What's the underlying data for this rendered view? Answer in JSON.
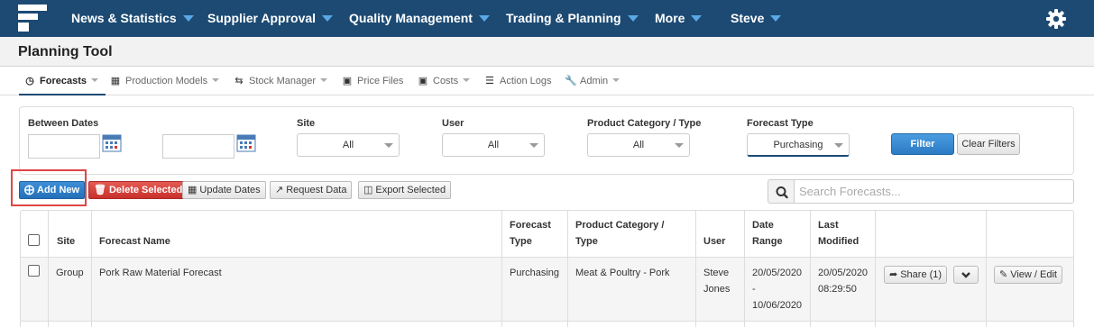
{
  "nav": {
    "logo_icon": "logo-icon",
    "items": [
      {
        "label": "News & Statistics"
      },
      {
        "label": "Supplier Approval"
      },
      {
        "label": "Quality Management"
      },
      {
        "label": "Trading & Planning"
      },
      {
        "label": "More"
      },
      {
        "label": "Steve"
      }
    ],
    "settings_icon": "gear-icon",
    "background": "#1c4a73"
  },
  "page": {
    "title": "Planning Tool"
  },
  "subnav": [
    {
      "label": "Forecasts",
      "icon": "clock-icon",
      "active": true
    },
    {
      "label": "Production Models",
      "icon": "calculator-icon"
    },
    {
      "label": "Stock Manager",
      "icon": "retweet-icon"
    },
    {
      "label": "Price Files",
      "icon": "money-icon"
    },
    {
      "label": "Costs",
      "icon": "money-icon"
    },
    {
      "label": "Action Logs",
      "icon": "list-icon"
    },
    {
      "label": "Admin",
      "icon": "wrench-icon"
    }
  ],
  "filters": {
    "between_dates_label": "Between Dates",
    "date_from": "",
    "date_to": "",
    "site_label": "Site",
    "site_value": "All",
    "user_label": "User",
    "user_value": "All",
    "category_label": "Product Category / Type",
    "category_value": "All",
    "forecast_type_label": "Forecast Type",
    "forecast_type_value": "Purchasing",
    "filter_button": "Filter",
    "clear_button": "Clear Filters"
  },
  "toolbar": {
    "add_new": "Add New",
    "delete_selected": "Delete Selected",
    "update_dates": "Update Dates",
    "request_data": "Request Data",
    "export_selected": "Export Selected",
    "search_placeholder": "Search Forecasts...",
    "search_value": ""
  },
  "table": {
    "headers": {
      "site": "Site",
      "forecast_name": "Forecast Name",
      "forecast_type_1": "Forecast",
      "forecast_type_2": "Type",
      "category_1": "Product Category /",
      "category_2": "Type",
      "user": "User",
      "date_range_1": "Date",
      "date_range_2": "Range",
      "last_modified_1": "Last",
      "last_modified_2": "Modified"
    },
    "rows": [
      {
        "site": "Group",
        "forecast_name": "Pork Raw Material Forecast",
        "forecast_type": "Purchasing",
        "category": "Meat & Poultry - Pork",
        "user_1": "Steve",
        "user_2": "Jones",
        "date_from": "20/05/2020",
        "date_sep": "-",
        "date_to": "10/06/2020",
        "modified_date": "20/05/2020",
        "modified_time": "08:29:50",
        "share_label": "Share (1)",
        "view_label": "View / Edit"
      }
    ]
  }
}
